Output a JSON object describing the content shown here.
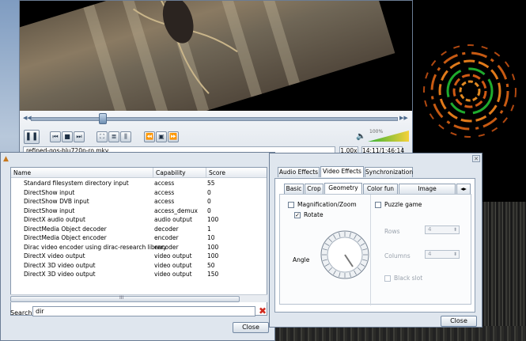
{
  "player": {
    "play_icon": "pause-icon",
    "filename": "refined-qos-blu720p-ro.mkv",
    "rate": "1.00x",
    "time": "14:11/1:46:14",
    "volume_label": "100%",
    "seek_progress": 0.22,
    "volume_level": 1.0
  },
  "modules": {
    "columns": [
      "Name",
      "Capability",
      "Score"
    ],
    "rows": [
      [
        "Standard filesystem directory input",
        "access",
        "55"
      ],
      [
        "DirectShow input",
        "access",
        "0"
      ],
      [
        "DirectShow DVB input",
        "access",
        "0"
      ],
      [
        "DirectShow input",
        "access_demux",
        "0"
      ],
      [
        "DirectX audio output",
        "audio output",
        "100"
      ],
      [
        "DirectMedia Object decoder",
        "decoder",
        "1"
      ],
      [
        "DirectMedia Object encoder",
        "encoder",
        "10"
      ],
      [
        "Dirac video encoder using dirac-research library",
        "encoder",
        "100"
      ],
      [
        "DirectX video output",
        "video output",
        "100"
      ],
      [
        "DirectX 3D video output",
        "video output",
        "50"
      ],
      [
        "DirectX 3D video output",
        "video output",
        "150"
      ]
    ],
    "search_label": "Search:",
    "search_value": "dir",
    "close_label": "Close",
    "scroll_glyph": "III"
  },
  "effects": {
    "tabs": [
      "Audio Effects",
      "Video Effects",
      "Synchronization"
    ],
    "subtabs": [
      "Basic",
      "Crop",
      "Geometry",
      "Color fun",
      "Image modification"
    ],
    "magnification_label": "Magnification/Zoom",
    "rotate_label": "Rotate",
    "angle_label": "Angle",
    "puzzle_label": "Puzzle game",
    "rows_label": "Rows",
    "rows_value": "4",
    "columns_label": "Columns",
    "columns_value": "4",
    "blackslot_label": "Black slot",
    "close_label": "Close",
    "rotate_checked": true,
    "magnification_checked": false,
    "puzzle_checked": false,
    "blackslot_checked": false
  }
}
